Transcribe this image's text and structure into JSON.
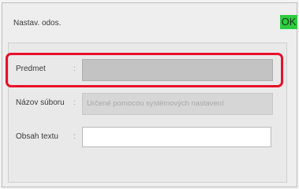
{
  "header": {
    "title": "Nastav. odos.",
    "ok_label": "OK",
    "ok_color": "#2ecc40"
  },
  "form": {
    "fields": [
      {
        "label": "Predmet",
        "separator": ":",
        "value": "",
        "placeholder": ""
      },
      {
        "label": "Názov súboru",
        "separator": ":",
        "value": "",
        "placeholder": "Určené pomocou systémových nastavení"
      },
      {
        "label": "Obsah textu",
        "separator": ":",
        "value": "",
        "placeholder": ""
      }
    ],
    "highlight_color": "#e8102a"
  }
}
